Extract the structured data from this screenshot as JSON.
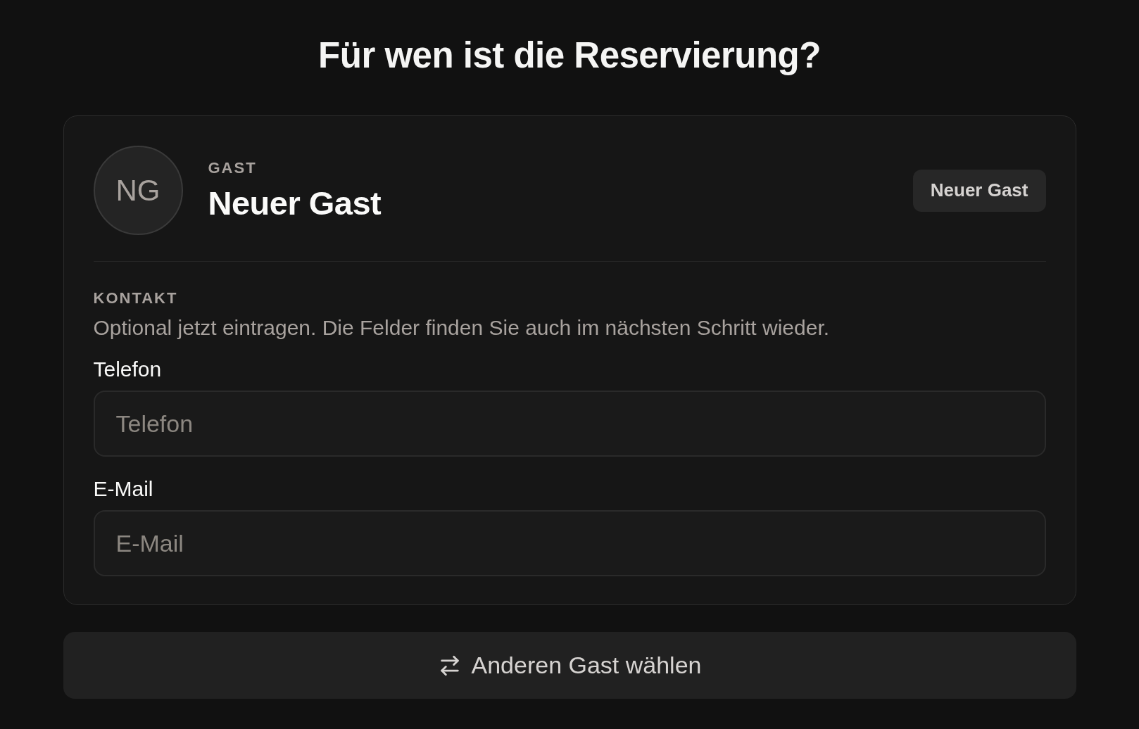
{
  "title": "Für wen ist die Reservierung?",
  "guest": {
    "initials": "NG",
    "label": "GAST",
    "name": "Neuer Gast",
    "badge": "Neuer Gast"
  },
  "contact": {
    "heading": "KONTAKT",
    "description": "Optional jetzt eintragen. Die Felder finden Sie auch im nächsten Schritt wieder.",
    "fields": [
      {
        "label": "Telefon",
        "placeholder": "Telefon"
      },
      {
        "label": "E-Mail",
        "placeholder": "E-Mail"
      }
    ]
  },
  "switch_button": {
    "label": "Anderen Gast wählen"
  }
}
